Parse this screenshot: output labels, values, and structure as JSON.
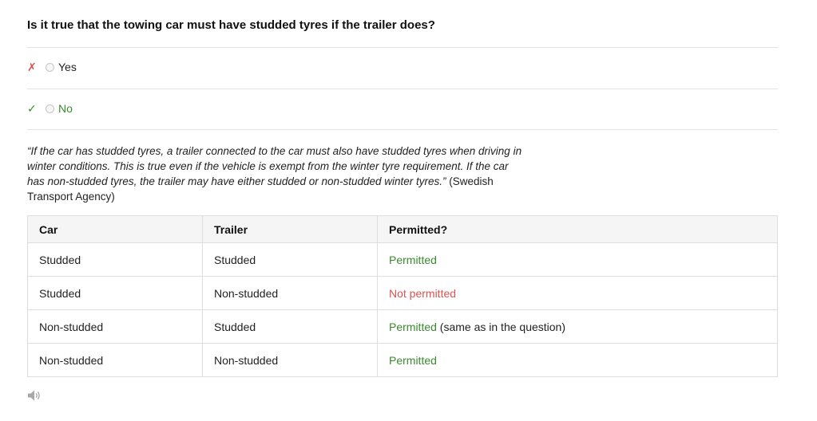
{
  "question": "Is it true that the towing car must have studded tyres if the trailer does?",
  "options": [
    {
      "mark": "✗",
      "label": "Yes",
      "status": "wrong"
    },
    {
      "mark": "✓",
      "label": "No",
      "status": "correct"
    }
  ],
  "explanation": {
    "quote": "“If the car has studded tyres, a trailer connected to the car must also have studded tyres when driving in winter conditions. This is true even if the vehicle is exempt from the winter tyre requirement. If the car has non-studded tyres, the trailer may have either studded or non-studded winter tyres.”",
    "source": " (Swedish Transport Agency)"
  },
  "table": {
    "headers": [
      "Car",
      "Trailer",
      "Permitted?"
    ],
    "rows": [
      {
        "car": "Studded",
        "trailer": "Studded",
        "permitted": "Permitted",
        "note": ""
      },
      {
        "car": "Studded",
        "trailer": "Non-studded",
        "permitted": "Not permitted",
        "note": ""
      },
      {
        "car": "Non-studded",
        "trailer": "Studded",
        "permitted": "Permitted",
        "note": " (same as in the question)"
      },
      {
        "car": "Non-studded",
        "trailer": "Non-studded",
        "permitted": "Permitted",
        "note": ""
      }
    ]
  },
  "colors": {
    "correct": "#3a8a2e",
    "wrong": "#d9534f"
  },
  "icons": {
    "speaker": "speaker-icon"
  }
}
